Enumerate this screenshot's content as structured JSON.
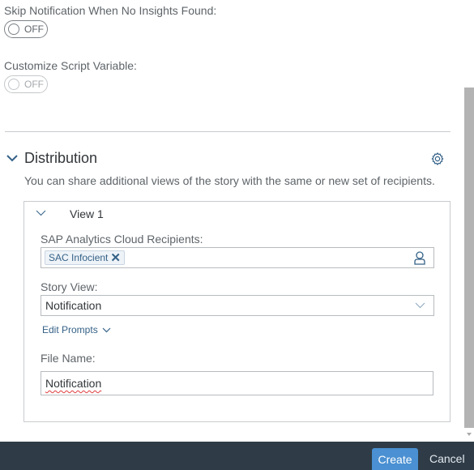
{
  "settings": {
    "skip_notification": {
      "label": "Skip Notification When No Insights Found:",
      "state": "OFF",
      "enabled": true
    },
    "customize_script": {
      "label": "Customize Script Variable:",
      "state": "OFF",
      "enabled": false
    }
  },
  "distribution": {
    "title": "Distribution",
    "description": "You can share additional views of the story with the same or new set of recipients.",
    "view": {
      "title": "View 1",
      "recipients_label": "SAP Analytics Cloud Recipients:",
      "recipients": [
        {
          "name": "SAC Infocient",
          "remove_icon": "close-icon"
        }
      ],
      "story_view_label": "Story View:",
      "story_view_value": "Notification",
      "edit_prompts_label": "Edit Prompts",
      "file_name_label": "File Name:",
      "file_name_value": "Notification"
    }
  },
  "footer": {
    "create_label": "Create",
    "cancel_label": "Cancel"
  },
  "colors": {
    "accent": "#346187",
    "primary_button": "#4a90d2",
    "footer_bg": "#2f3c48"
  }
}
